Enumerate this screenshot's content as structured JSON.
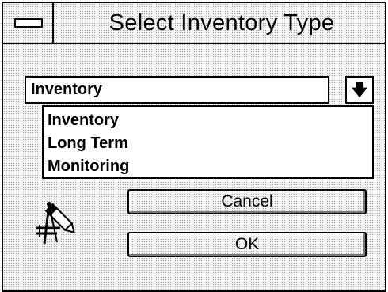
{
  "window": {
    "title": "Select Inventory Type"
  },
  "combo": {
    "value": "Inventory",
    "dropdown_icon": "down-arrow-icon"
  },
  "list": {
    "items": [
      {
        "label": "Inventory"
      },
      {
        "label": "Long Term"
      },
      {
        "label": "Monitoring"
      }
    ]
  },
  "buttons": {
    "cancel_label": "Cancel",
    "ok_label": "OK"
  },
  "icons": {
    "system_menu": "system-menu-icon",
    "app": "drafting-tools-icon"
  }
}
